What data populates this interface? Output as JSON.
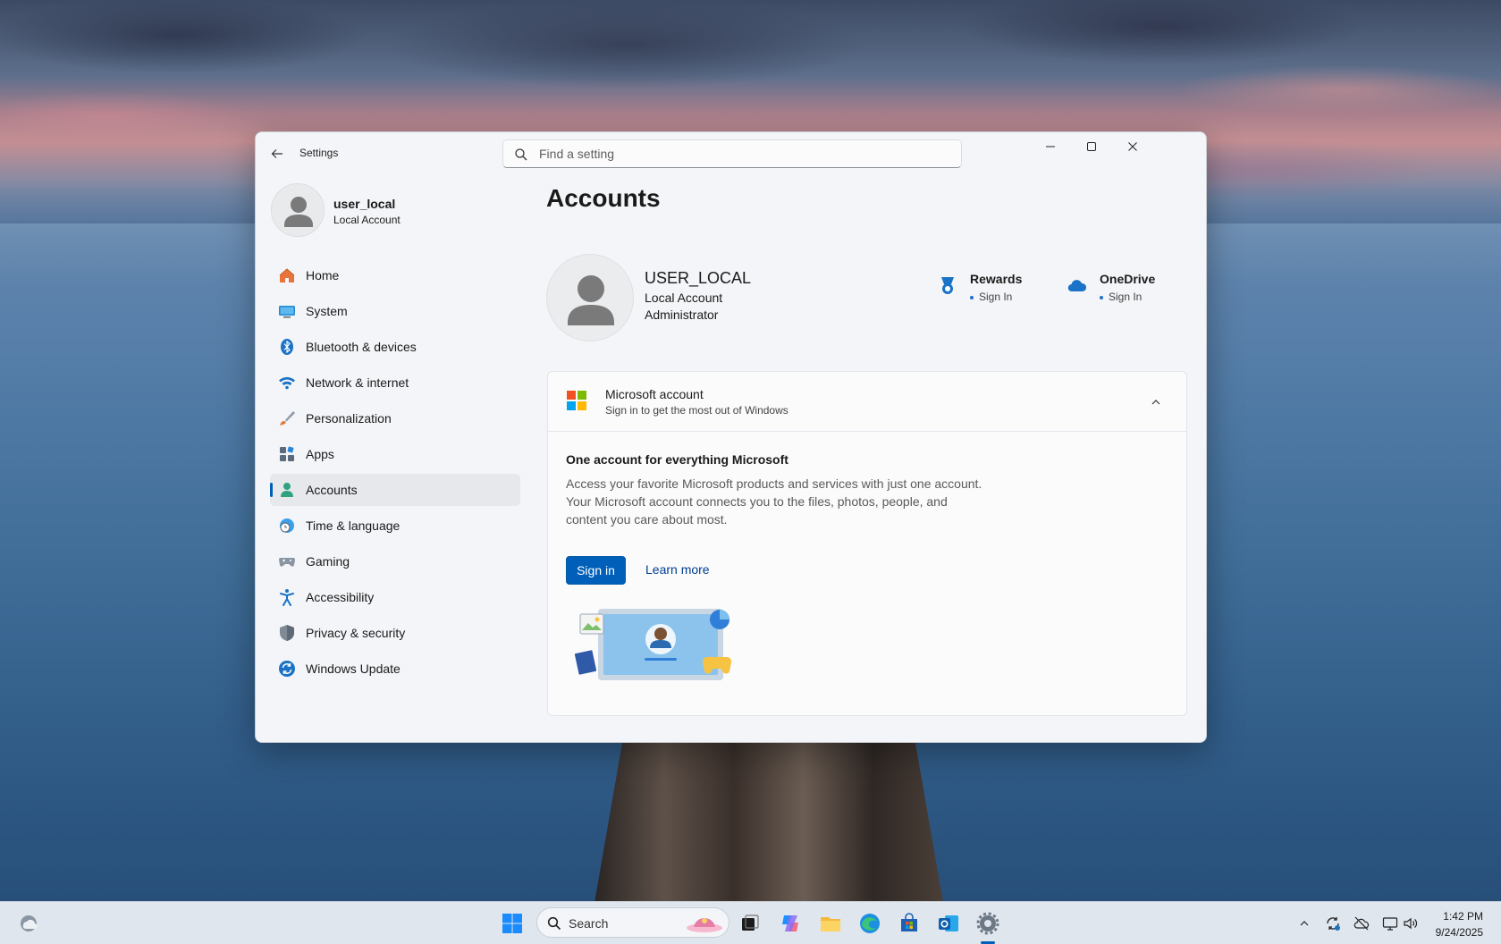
{
  "window": {
    "app_title": "Settings",
    "search_placeholder": "Find a setting"
  },
  "profile": {
    "name": "user_local",
    "type": "Local Account"
  },
  "nav": [
    {
      "label": "Home",
      "icon": "home-icon",
      "color": "#e8743b"
    },
    {
      "label": "System",
      "icon": "system-icon",
      "color": "#1f8ad2"
    },
    {
      "label": "Bluetooth & devices",
      "icon": "bluetooth-icon",
      "color": "#1a73c6"
    },
    {
      "label": "Network & internet",
      "icon": "wifi-icon",
      "color": "#1a73c6"
    },
    {
      "label": "Personalization",
      "icon": "brush-icon",
      "color": "#e07b39"
    },
    {
      "label": "Apps",
      "icon": "apps-icon",
      "color": "#5b6b7d"
    },
    {
      "label": "Accounts",
      "icon": "accounts-icon",
      "color": "#2fa37e",
      "selected": true
    },
    {
      "label": "Time & language",
      "icon": "clock-globe-icon",
      "color": "#1a73c6"
    },
    {
      "label": "Gaming",
      "icon": "gamepad-icon",
      "color": "#7f8a96"
    },
    {
      "label": "Accessibility",
      "icon": "accessibility-icon",
      "color": "#1a73c6"
    },
    {
      "label": "Privacy & security",
      "icon": "shield-icon",
      "color": "#7f8a96"
    },
    {
      "label": "Windows Update",
      "icon": "update-icon",
      "color": "#1a73c6"
    }
  ],
  "main": {
    "title": "Accounts",
    "user_name": "USER_LOCAL",
    "account_type": "Local Account",
    "role": "Administrator",
    "services": [
      {
        "title": "Rewards",
        "status": "Sign In",
        "icon": "rewards-icon"
      },
      {
        "title": "OneDrive",
        "status": "Sign In",
        "icon": "onedrive-icon"
      }
    ],
    "ms_card": {
      "title": "Microsoft account",
      "subtitle": "Sign in to get the most out of Windows",
      "section_title": "One account for everything Microsoft",
      "body": "Access your favorite Microsoft products and services with just one account. Your Microsoft account connects you to the files, photos, people, and content you care about most.",
      "signin_label": "Sign in",
      "learn_more_label": "Learn more"
    }
  },
  "taskbar": {
    "search_label": "Search",
    "time": "1:42 PM",
    "date": "9/24/2025"
  },
  "colors": {
    "accent": "#005fb8",
    "window_bg": "#f3f5f8",
    "card_bg": "#fbfbfc"
  }
}
